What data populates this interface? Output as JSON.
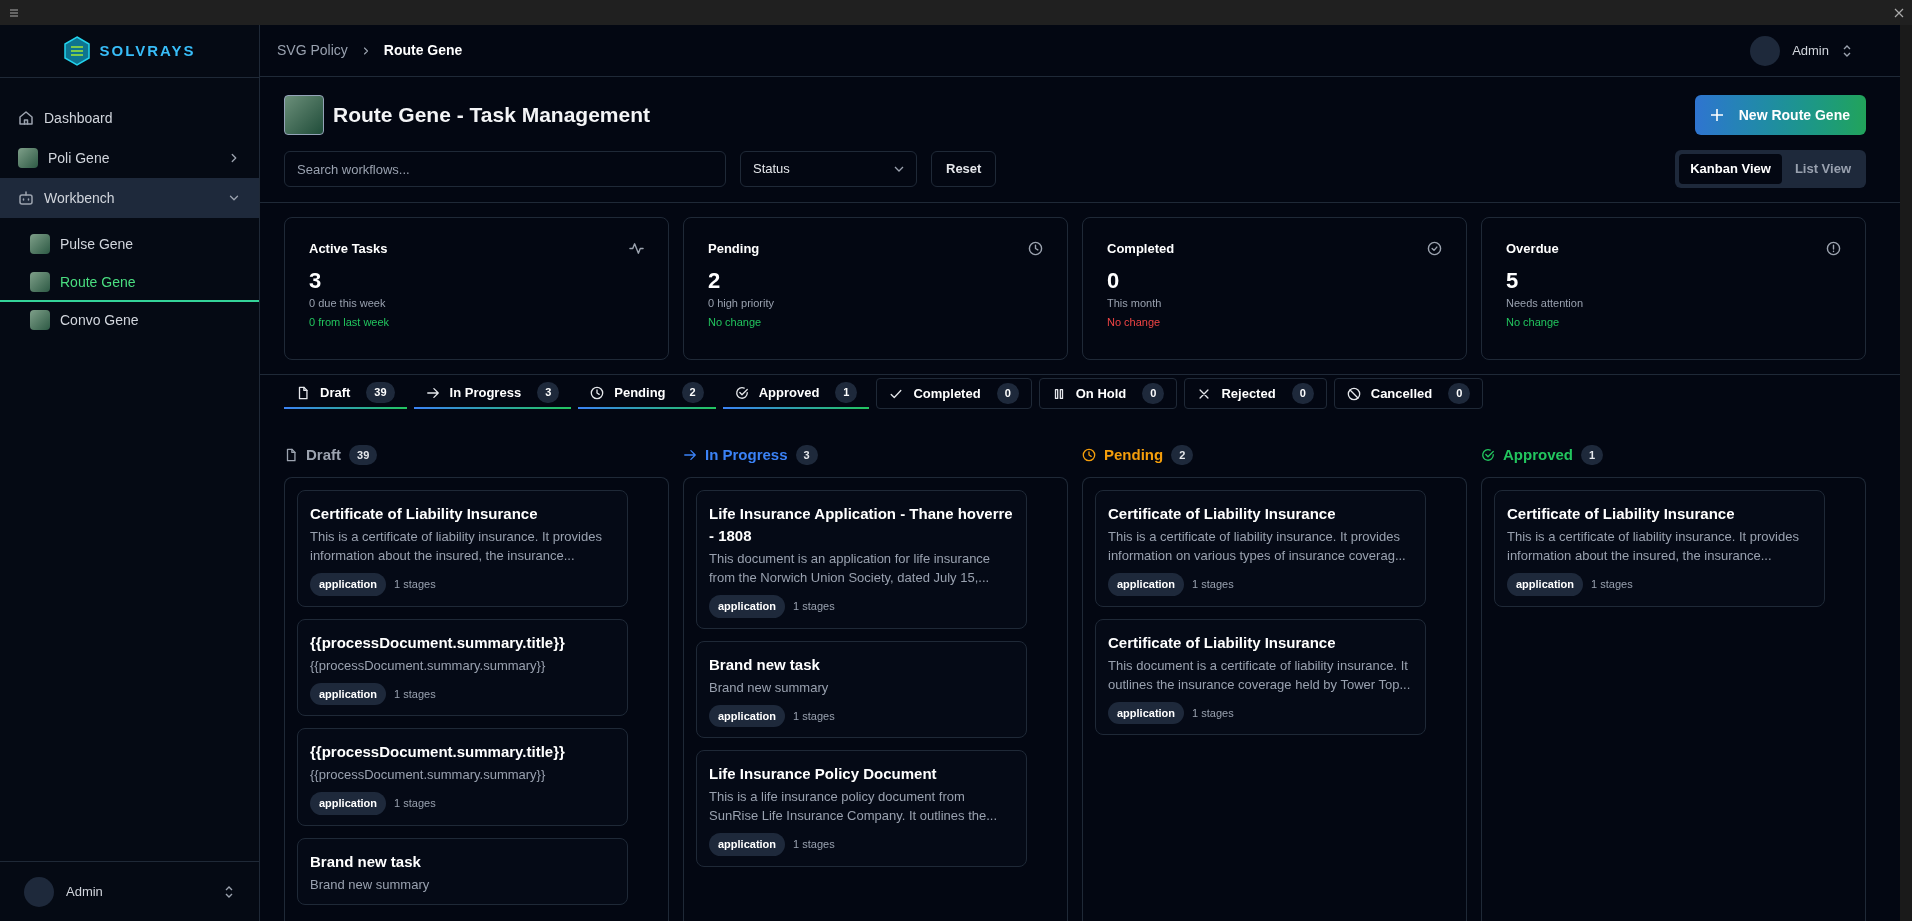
{
  "logo": {
    "text": "SOLVRAYS"
  },
  "sidebar": {
    "items": [
      {
        "label": "Dashboard",
        "kind": "page"
      },
      {
        "label": "Poli Gene",
        "kind": "gene",
        "expanded": false
      },
      {
        "label": "Workbench",
        "kind": "workspace",
        "expanded": true,
        "children": [
          {
            "label": "Pulse Gene",
            "selected": false
          },
          {
            "label": "Route Gene",
            "selected": true
          },
          {
            "label": "Convo Gene",
            "selected": false
          }
        ]
      }
    ],
    "user": {
      "name": "Admin"
    }
  },
  "header": {
    "breadcrumb": [
      "SVG Policy",
      "Route Gene"
    ],
    "user": {
      "name": "Admin"
    }
  },
  "page": {
    "title": "Route Gene - Task Management",
    "new_button": "New Route Gene",
    "search": {
      "placeholder": "Search workflows..."
    },
    "status_filter": "Status",
    "reset": "Reset",
    "views": [
      {
        "label": "Kanban View",
        "selected": true
      },
      {
        "label": "List View",
        "selected": false
      }
    ]
  },
  "stats": [
    {
      "kind": "activity",
      "title": "Active Tasks",
      "value": "3",
      "subtitle": "0 due this week",
      "change": "0 from last week",
      "color": "#22c55e"
    },
    {
      "kind": "clock",
      "title": "Pending",
      "value": "2",
      "subtitle": "0 high priority",
      "change": "No change",
      "color": "#22c55e"
    },
    {
      "kind": "done",
      "title": "Completed",
      "value": "0",
      "subtitle": "This month",
      "change": "No change",
      "color": "#ef4444"
    },
    {
      "kind": "alert",
      "title": "Overdue",
      "value": "5",
      "subtitle": "Needs attention",
      "change": "No change",
      "color": "#22c55e"
    }
  ],
  "status_tabs": [
    {
      "kind": "draft",
      "label": "Draft",
      "count": "39",
      "shown": true
    },
    {
      "kind": "in_progress",
      "label": "In Progress",
      "count": "3",
      "shown": true
    },
    {
      "kind": "pending",
      "label": "Pending",
      "count": "2",
      "shown": true
    },
    {
      "kind": "approved",
      "label": "Approved",
      "count": "1",
      "shown": true
    },
    {
      "kind": "completed",
      "label": "Completed",
      "count": "0",
      "shown": false
    },
    {
      "kind": "on_hold",
      "label": "On Hold",
      "count": "0",
      "shown": false
    },
    {
      "kind": "rejected",
      "label": "Rejected",
      "count": "0",
      "shown": false
    },
    {
      "kind": "cancelled",
      "label": "Cancelled",
      "count": "0",
      "shown": false
    }
  ],
  "columns": [
    {
      "kind": "draft",
      "label": "Draft",
      "count": "39",
      "color": "#9ca3af",
      "cards": [
        {
          "title": "Certificate of Liability Insurance",
          "summary": "This is a certificate of liability insurance. It provides information about the insured, the insurance...",
          "tag": "application",
          "stages": "1 stages"
        },
        {
          "title": "{{processDocument.summary.title}}",
          "summary": "{{processDocument.summary.summary}}",
          "tag": "application",
          "stages": "1 stages"
        },
        {
          "title": "{{processDocument.summary.title}}",
          "summary": "{{processDocument.summary.summary}}",
          "tag": "application",
          "stages": "1 stages"
        },
        {
          "title": "Brand new task",
          "summary": "Brand new summary"
        }
      ]
    },
    {
      "kind": "in_progress",
      "label": "In Progress",
      "count": "3",
      "color": "#3b82f6",
      "cards": [
        {
          "title": "Life Insurance Application - Thane hoverre - 1808",
          "summary": "This document is an application for life insurance from the Norwich Union Society, dated July 15,...",
          "tag": "application",
          "stages": "1 stages"
        },
        {
          "title": "Brand new task",
          "summary": "Brand new summary",
          "tag": "application",
          "stages": "1 stages"
        },
        {
          "title": "Life Insurance Policy Document",
          "summary": "This is a life insurance policy document from SunRise Life Insurance Company. It outlines the...",
          "tag": "application",
          "stages": "1 stages"
        }
      ]
    },
    {
      "kind": "pending",
      "label": "Pending",
      "count": "2",
      "color": "#f59e0b",
      "cards": [
        {
          "title": "Certificate of Liability Insurance",
          "summary": "This is a certificate of liability insurance. It provides information on various types of insurance coverag...",
          "tag": "application",
          "stages": "1 stages"
        },
        {
          "title": "Certificate of Liability Insurance",
          "summary": "This document is a certificate of liability insurance. It outlines the insurance coverage held by Tower Top...",
          "tag": "application",
          "stages": "1 stages"
        }
      ]
    },
    {
      "kind": "approved",
      "label": "Approved",
      "count": "1",
      "color": "#22c55e",
      "cards": [
        {
          "title": "Certificate of Liability Insurance",
          "summary": "This is a certificate of liability insurance. It provides information about the insured, the insurance...",
          "tag": "application",
          "stages": "1 stages"
        }
      ]
    }
  ]
}
